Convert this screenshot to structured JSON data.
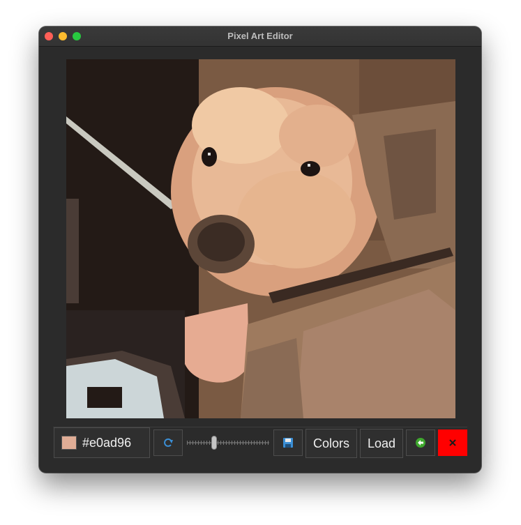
{
  "window": {
    "title": "Pixel Art Editor"
  },
  "canvas": {
    "image_description_alt": ""
  },
  "toolbar": {
    "color_value": "#e0ad96",
    "swatch_color": "#e0ad96",
    "brush_size_level": 0.32,
    "colors_label": "Colors",
    "load_label": "Load",
    "icons": {
      "refresh": "refresh-icon",
      "save": "save-icon",
      "undo": "undo-icon",
      "clear": "clear-icon"
    }
  },
  "colors": {
    "accent_clear": "#ff0000",
    "icon_blue": "#3b8fd6",
    "icon_green": "#3fa82e"
  }
}
